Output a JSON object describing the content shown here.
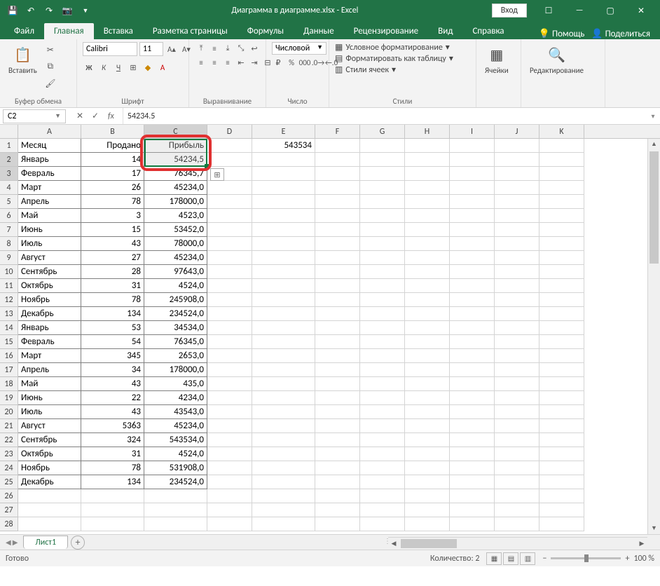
{
  "title": "Диаграмма в диаграмме.xlsx  -  Excel",
  "login": "Вход",
  "tabs": [
    "Файл",
    "Главная",
    "Вставка",
    "Разметка страницы",
    "Формулы",
    "Данные",
    "Рецензирование",
    "Вид",
    "Справка"
  ],
  "tabs_right": {
    "tellme": "Помощь",
    "share": "Поделиться"
  },
  "groups": {
    "clipboard": {
      "label": "Буфер обмена",
      "paste": "Вставить"
    },
    "font": {
      "label": "Шрифт",
      "name": "Calibri",
      "size": "11"
    },
    "align": {
      "label": "Выравнивание"
    },
    "number": {
      "label": "Число",
      "format": "Числовой"
    },
    "styles": {
      "label": "Стили",
      "cond": "Условное форматирование",
      "table": "Форматировать как таблицу",
      "cell": "Стили ячеек"
    },
    "cells": {
      "label": "Ячейки"
    },
    "editing": {
      "label": "Редактирование"
    }
  },
  "namebox": "C2",
  "formula": "54234.5",
  "columns": [
    "A",
    "B",
    "C",
    "D",
    "E",
    "F",
    "G",
    "H",
    "I",
    "J",
    "K"
  ],
  "headers": {
    "A": "Месяц",
    "B": "Продано",
    "C": "Прибыль"
  },
  "e1": "543534",
  "rows": [
    {
      "n": 2,
      "a": "Январь",
      "b": "14",
      "c": "54234,5"
    },
    {
      "n": 3,
      "a": "Февраль",
      "b": "17",
      "c": "76345,7"
    },
    {
      "n": 4,
      "a": "Март",
      "b": "26",
      "c": "45234,0"
    },
    {
      "n": 5,
      "a": "Апрель",
      "b": "78",
      "c": "178000,0"
    },
    {
      "n": 6,
      "a": "Май",
      "b": "3",
      "c": "4523,0"
    },
    {
      "n": 7,
      "a": "Июнь",
      "b": "15",
      "c": "53452,0"
    },
    {
      "n": 8,
      "a": "Июль",
      "b": "43",
      "c": "78000,0"
    },
    {
      "n": 9,
      "a": "Август",
      "b": "27",
      "c": "45234,0"
    },
    {
      "n": 10,
      "a": "Сентябрь",
      "b": "28",
      "c": "97643,0"
    },
    {
      "n": 11,
      "a": "Октябрь",
      "b": "31",
      "c": "4524,0"
    },
    {
      "n": 12,
      "a": "Ноябрь",
      "b": "78",
      "c": "245908,0"
    },
    {
      "n": 13,
      "a": "Декабрь",
      "b": "134",
      "c": "234524,0"
    },
    {
      "n": 14,
      "a": "Январь",
      "b": "53",
      "c": "34534,0"
    },
    {
      "n": 15,
      "a": "Февраль",
      "b": "54",
      "c": "76345,0"
    },
    {
      "n": 16,
      "a": "Март",
      "b": "345",
      "c": "2653,0"
    },
    {
      "n": 17,
      "a": "Апрель",
      "b": "34",
      "c": "178000,0"
    },
    {
      "n": 18,
      "a": "Май",
      "b": "43",
      "c": "435,0"
    },
    {
      "n": 19,
      "a": "Июнь",
      "b": "22",
      "c": "4234,0"
    },
    {
      "n": 20,
      "a": "Июль",
      "b": "43",
      "c": "43543,0"
    },
    {
      "n": 21,
      "a": "Август",
      "b": "5363",
      "c": "45234,0"
    },
    {
      "n": 22,
      "a": "Сентябрь",
      "b": "324",
      "c": "543534,0"
    },
    {
      "n": 23,
      "a": "Октябрь",
      "b": "31",
      "c": "4524,0"
    },
    {
      "n": 24,
      "a": "Ноябрь",
      "b": "78",
      "c": "531908,0"
    },
    {
      "n": 25,
      "a": "Декабрь",
      "b": "134",
      "c": "234524,0"
    }
  ],
  "sheet": "Лист1",
  "status": {
    "ready": "Готово",
    "count": "Количество: 2",
    "zoom": "100 %"
  }
}
